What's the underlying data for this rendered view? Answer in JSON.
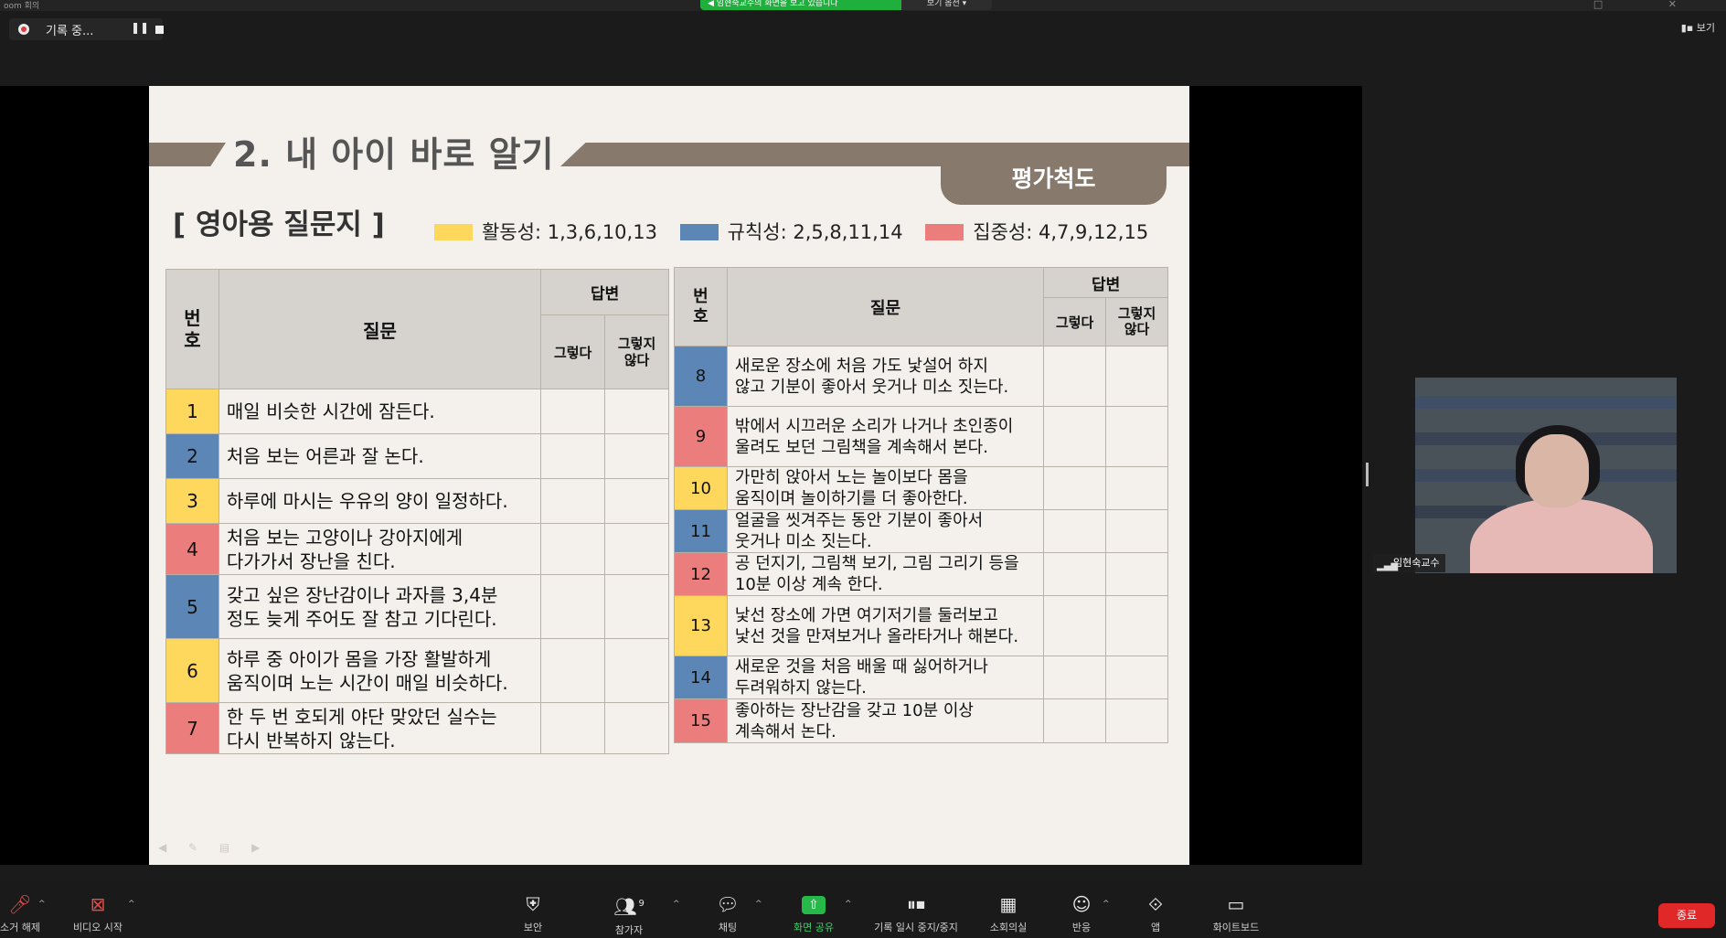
{
  "topbar": {
    "app_title": "oom 회의",
    "share_banner": "◀ 임현숙교수의 화면을 보고 있습니다",
    "view_options": "보기 옵션 ▾",
    "window_controls": "□ ✕"
  },
  "recording": {
    "label": "기록 중...",
    "pause_glyph": "❚❚"
  },
  "view_button": "보기",
  "slide": {
    "title": "2. 내 아이 바로 알기",
    "eval_tab": "평가척도",
    "subtitle": "[ 영아용 질문지 ]",
    "legend": [
      {
        "label": "활동성: 1,3,6,10,13",
        "color": "#fdd85c"
      },
      {
        "label": "규칙성: 2,5,8,11,14",
        "color": "#5b86b5"
      },
      {
        "label": "집중성: 4,7,9,12,15",
        "color": "#ec7d7d"
      }
    ],
    "headers": {
      "num": "번\n호",
      "question": "질문",
      "answer": "답변",
      "yes": "그렇다",
      "no": "그렇지\n않다"
    },
    "left_rows": [
      {
        "num": "1",
        "text": "매일 비슷한 시간에 잠든다."
      },
      {
        "num": "2",
        "text": "처음 보는 어른과 잘 논다."
      },
      {
        "num": "3",
        "text": "하루에 마시는 우유의 양이 일정하다."
      },
      {
        "num": "4",
        "text": "처음 보는 고양이나 강아지에게\n다가가서 장난을 친다."
      },
      {
        "num": "5",
        "text": "갖고 싶은 장난감이나 과자를 3,4분\n정도 늦게 주어도 잘 참고 기다린다."
      },
      {
        "num": "6",
        "text": "하루 중 아이가 몸을 가장 활발하게\n움직이며 노는 시간이 매일 비슷하다."
      },
      {
        "num": "7",
        "text": "한 두 번 호되게 야단 맞았던 실수는\n다시 반복하지 않는다."
      }
    ],
    "right_rows": [
      {
        "num": "8",
        "text": "새로운 장소에 처음 가도 낯설어 하지\n않고 기분이 좋아서 웃거나 미소 짓는다."
      },
      {
        "num": "9",
        "text": "밖에서 시끄러운 소리가 나거나 초인종이\n울려도 보던 그림책을 계속해서 본다."
      },
      {
        "num": "10",
        "text": "가만히 앉아서 노는 놀이보다 몸을\n움직이며 놀이하기를 더 좋아한다."
      },
      {
        "num": "11",
        "text": "얼굴을 씻겨주는 동안 기분이 좋아서\n웃거나 미소 짓는다."
      },
      {
        "num": "12",
        "text": "공 던지기, 그림책 보기, 그림 그리기 등을\n10분 이상 계속 한다."
      },
      {
        "num": "13",
        "text": "낯선 장소에 가면 여기저기를 둘러보고\n낯선 것을 만져보거나 올라타거나 해본다."
      },
      {
        "num": "14",
        "text": "새로운 것을 처음 배울 때 싫어하거나\n두려워하지 않는다."
      },
      {
        "num": "15",
        "text": "좋아하는 장난감을 갖고 10분 이상\n계속해서 논다."
      }
    ]
  },
  "participant": {
    "name": "임현숙교수"
  },
  "toolbar": {
    "unmute": "소거 해제",
    "video": "비디오 시작",
    "security": "보안",
    "participants": "참가자",
    "participants_count": "9",
    "chat": "채팅",
    "share": "화면 공유",
    "record_pause": "기록 일시 중지/중지",
    "breakout": "소회의실",
    "reactions": "반응",
    "apps": "앱",
    "whiteboard": "화이트보드",
    "end": "종료"
  }
}
